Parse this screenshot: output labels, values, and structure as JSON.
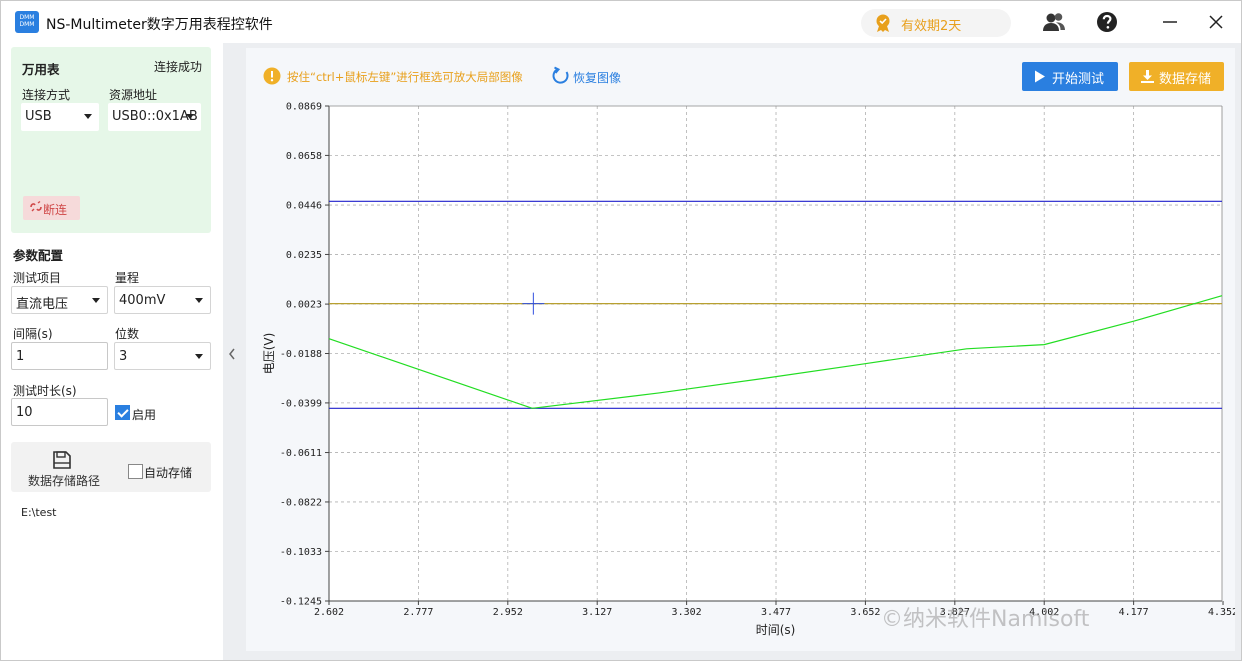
{
  "titlebar": {
    "logo_text_top": "DMM",
    "logo_text_bottom": "DMM",
    "title": "NS-Multimeter数字万用表程控软件",
    "validity": "有效期2天",
    "accent_color": "#e8a01c"
  },
  "meter": {
    "heading": "万用表",
    "status": "连接成功",
    "connection_label": "连接方式",
    "connection_value": "USB",
    "resource_label": "资源地址",
    "resource_value": "USB0::0x1AB",
    "disconnect_label": "断连",
    "panel_color": "#e6f7e8"
  },
  "params": {
    "heading": "参数配置",
    "item_label": "测试项目",
    "item_value": "直流电压",
    "range_label": "量程",
    "range_value": "400mV",
    "interval_label": "间隔(s)",
    "interval_value": "1",
    "digits_label": "位数",
    "digits_value": "3",
    "duration_label": "测试时长(s)",
    "duration_value": "10",
    "enable_label": "启用",
    "enable_checked": true
  },
  "storage": {
    "path_button_label": "数据存储路径",
    "auto_save_label": "自动存储",
    "auto_save_checked": false,
    "path": "E:\\test"
  },
  "toolbar": {
    "hint": "按住“ctrl+鼠标左键”进行框选可放大局部图像",
    "restore_label": "恢复图像",
    "start_label": "开始测试",
    "save_label": "数据存储",
    "start_color": "#2a7fe0",
    "save_color": "#f0b028"
  },
  "chart_data": {
    "type": "line",
    "xlabel": "时间(s)",
    "ylabel": "电压(V)",
    "xlim": [
      2.602,
      4.35
    ],
    "ylim": [
      -0.1245,
      0.0869
    ],
    "x_ticks": [
      "2.602",
      "2.777",
      "2.952",
      "3.127",
      "3.302",
      "3.477",
      "3.652",
      "3.827",
      "4.002",
      "4.177",
      "4.352"
    ],
    "x_tick_values": [
      2.602,
      2.777,
      2.952,
      3.127,
      3.302,
      3.477,
      3.652,
      3.827,
      4.002,
      4.177,
      4.352
    ],
    "y_ticks": [
      "0.0869",
      "0.0658",
      "0.0446",
      "0.0235",
      "0.0023",
      "-0.0188",
      "-0.0399",
      "-0.0611",
      "-0.0822",
      "-0.1033",
      "-0.1245"
    ],
    "y_tick_values": [
      0.0869,
      0.0658,
      0.0446,
      0.0235,
      0.0023,
      -0.0188,
      -0.0399,
      -0.0611,
      -0.0822,
      -0.1033,
      -0.1245
    ],
    "grid": true,
    "series": [
      {
        "color": "#22dd22",
        "x": [
          2.602,
          3.0,
          3.25,
          3.45,
          3.65,
          3.85,
          4.002,
          4.177,
          4.35
        ],
        "values": [
          -0.0125,
          -0.0422,
          -0.0356,
          -0.0295,
          -0.0232,
          -0.0168,
          -0.015,
          -0.005,
          0.0059
        ]
      }
    ],
    "hlines": [
      {
        "y": 0.0462,
        "color": "#2020cc"
      },
      {
        "y": 0.0025,
        "color": "#b8a030"
      },
      {
        "y": -0.0422,
        "color": "#2020cc"
      }
    ],
    "cursor": {
      "x": 3.002,
      "y": 0.0025,
      "color": "#3050e0"
    }
  },
  "watermark": "©纳米软件Namisoft"
}
